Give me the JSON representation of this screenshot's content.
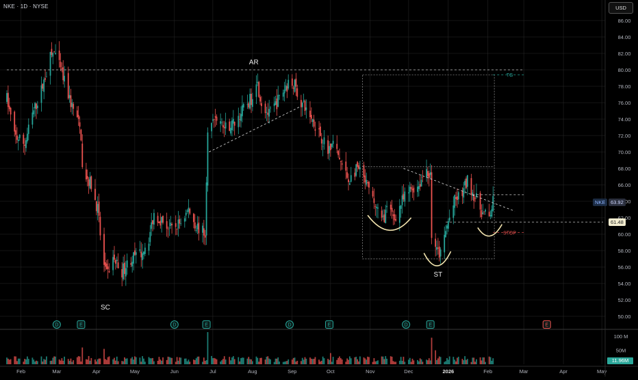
{
  "header": {
    "ticker_line": "NKE · 1D · NYSE",
    "currency": "USD"
  },
  "price_badges": {
    "symbol": "NKE",
    "last": "63.92",
    "level": "61.48"
  },
  "volume_last": "11.96M",
  "colors": {
    "up": "#26a69a",
    "down": "#ef5350",
    "annotation": "#f5e6b0",
    "target": "#26a69a",
    "stop": "#ef5350",
    "grid": "#2a2a2a"
  },
  "annotations": {
    "sc": "SC",
    "ar": "AR",
    "st": "ST",
    "tg": "TG",
    "stop": "STOP"
  },
  "event_markers": [
    {
      "label": "D",
      "kind": "dividend",
      "date": "2025-03-01"
    },
    {
      "label": "E",
      "kind": "earnings",
      "date": "2025-03-20"
    },
    {
      "label": "D",
      "kind": "dividend",
      "date": "2025-06-01"
    },
    {
      "label": "E",
      "kind": "earnings",
      "date": "2025-06-26"
    },
    {
      "label": "D",
      "kind": "dividend",
      "date": "2025-08-30"
    },
    {
      "label": "E",
      "kind": "earnings",
      "date": "2025-09-30"
    },
    {
      "label": "D",
      "kind": "dividend",
      "date": "2025-11-29"
    },
    {
      "label": "E",
      "kind": "earnings",
      "date": "2025-12-18"
    },
    {
      "label": "E",
      "kind": "earnings-upcoming",
      "date": "2026-03-19"
    }
  ],
  "chart_data": {
    "type": "candlestick",
    "title": "NKE · 1D · NYSE",
    "y_axis": {
      "side": "right",
      "unit": "USD",
      "min": 49,
      "max": 87,
      "ticks": [
        50,
        52,
        54,
        56,
        58,
        60,
        62,
        64,
        66,
        68,
        70,
        72,
        74,
        76,
        78,
        80,
        82,
        84,
        86
      ],
      "tick_labels": [
        "50.00",
        "52.00",
        "54.00",
        "56.00",
        "58.00",
        "60.00",
        "62.00",
        "64.00",
        "66.00",
        "68.00",
        "70.00",
        "72.00",
        "74.00",
        "76.00",
        "78.00",
        "80.00",
        "82.00",
        "84.00",
        "86.00"
      ]
    },
    "x_axis": {
      "ticks": [
        "2025-02-01",
        "2025-03-01",
        "2025-04-01",
        "2025-05-01",
        "2025-06-01",
        "2025-07-01",
        "2025-08-01",
        "2025-09-01",
        "2025-10-01",
        "2025-11-01",
        "2025-12-01",
        "2026-01-01",
        "2026-02-01",
        "2026-03-01",
        "2026-04-01",
        "2026-05-01"
      ],
      "tick_labels": [
        "Feb",
        "Mar",
        "Apr",
        "May",
        "Jun",
        "Jul",
        "Aug",
        "Sep",
        "Oct",
        "Nov",
        "Dec",
        "2026",
        "Feb",
        "Mar",
        "Apr",
        "May"
      ],
      "range": [
        "2025-01-21",
        "2026-05-02"
      ]
    },
    "volume_axis": {
      "tick_labels": [
        "100 M",
        "50M"
      ],
      "ticks": [
        100,
        50
      ],
      "max": 120,
      "unit": "M"
    },
    "price_path": [
      [
        "2025-01-21",
        76.5
      ],
      [
        "2025-01-27",
        72.0
      ],
      [
        "2025-02-04",
        71.0
      ],
      [
        "2025-02-10",
        74.5
      ],
      [
        "2025-02-17",
        77.5
      ],
      [
        "2025-02-24",
        81.5
      ],
      [
        "2025-02-27",
        82.2
      ],
      [
        "2025-03-05",
        79.5
      ],
      [
        "2025-03-12",
        76.0
      ],
      [
        "2025-03-17",
        74.0
      ],
      [
        "2025-03-20",
        72.0
      ],
      [
        "2025-03-21",
        68.0
      ],
      [
        "2025-03-28",
        66.0
      ],
      [
        "2025-04-02",
        63.0
      ],
      [
        "2025-04-04",
        60.0
      ],
      [
        "2025-04-07",
        56.0
      ],
      [
        "2025-04-09",
        55.0
      ],
      [
        "2025-04-14",
        57.0
      ],
      [
        "2025-04-21",
        55.5
      ],
      [
        "2025-04-28",
        57.0
      ],
      [
        "2025-05-05",
        57.5
      ],
      [
        "2025-05-12",
        59.5
      ],
      [
        "2025-05-16",
        62.5
      ],
      [
        "2025-05-23",
        61.5
      ],
      [
        "2025-05-30",
        60.5
      ],
      [
        "2025-06-06",
        61.5
      ],
      [
        "2025-06-12",
        63.0
      ],
      [
        "2025-06-18",
        61.0
      ],
      [
        "2025-06-25",
        60.0
      ],
      [
        "2025-06-27",
        72.0
      ],
      [
        "2025-07-03",
        74.5
      ],
      [
        "2025-07-10",
        73.0
      ],
      [
        "2025-07-17",
        73.5
      ],
      [
        "2025-07-24",
        75.0
      ],
      [
        "2025-07-31",
        76.5
      ],
      [
        "2025-08-04",
        79.0
      ],
      [
        "2025-08-08",
        76.0
      ],
      [
        "2025-08-14",
        74.5
      ],
      [
        "2025-08-20",
        76.0
      ],
      [
        "2025-08-27",
        78.0
      ],
      [
        "2025-09-02",
        78.5
      ],
      [
        "2025-09-08",
        76.0
      ],
      [
        "2025-09-15",
        74.5
      ],
      [
        "2025-09-22",
        72.5
      ],
      [
        "2025-09-29",
        70.0
      ],
      [
        "2025-10-02",
        71.5
      ],
      [
        "2025-10-08",
        69.0
      ],
      [
        "2025-10-15",
        66.5
      ],
      [
        "2025-10-22",
        68.0
      ],
      [
        "2025-10-29",
        66.0
      ],
      [
        "2025-11-05",
        63.5
      ],
      [
        "2025-11-10",
        61.5
      ],
      [
        "2025-11-14",
        63.0
      ],
      [
        "2025-11-20",
        62.0
      ],
      [
        "2025-11-26",
        64.0
      ],
      [
        "2025-12-03",
        65.5
      ],
      [
        "2025-12-09",
        66.0
      ],
      [
        "2025-12-15",
        68.0
      ],
      [
        "2025-12-18",
        67.0
      ],
      [
        "2025-12-19",
        60.0
      ],
      [
        "2025-12-22",
        58.0
      ],
      [
        "2025-12-26",
        57.5
      ],
      [
        "2025-12-31",
        61.0
      ],
      [
        "2026-01-06",
        64.0
      ],
      [
        "2026-01-12",
        65.0
      ],
      [
        "2026-01-16",
        66.5
      ],
      [
        "2026-01-22",
        64.5
      ],
      [
        "2026-01-28",
        62.5
      ],
      [
        "2026-02-02",
        62.0
      ],
      [
        "2026-02-05",
        63.9
      ]
    ],
    "levels": [
      {
        "label": "AR",
        "value": 80.0,
        "style": "dashed",
        "from": "2025-01-21",
        "to": "2026-03-01"
      },
      {
        "label": "TG",
        "value": 79.4,
        "style": "dashed",
        "from": "2026-02-05",
        "to": "2026-03-01"
      },
      {
        "label": "",
        "value": 64.8,
        "style": "dashed",
        "from": "2026-01-20",
        "to": "2026-03-01"
      },
      {
        "label": "",
        "value": 61.48,
        "style": "dashed",
        "from": "2025-12-30",
        "to": "2026-05-02"
      },
      {
        "label": "STOP",
        "value": 60.2,
        "style": "dashed",
        "from": "2026-02-05",
        "to": "2026-03-01"
      }
    ],
    "trendlines": [
      {
        "from": [
          "2025-06-28",
          70.0
        ],
        "to": [
          "2025-09-07",
          75.5
        ]
      },
      {
        "from": [
          "2025-11-27",
          68.0
        ],
        "to": [
          "2026-02-22",
          62.8
        ]
      }
    ],
    "range_box": {
      "from": "2025-10-26",
      "to": "2026-02-06",
      "top": 79.4,
      "bottom": 57.0,
      "mid": 68.2
    },
    "labels": [
      {
        "text": "SC",
        "date": "2025-04-08",
        "value": 51.1
      },
      {
        "text": "AR",
        "date": "2025-08-02",
        "value": 80.9
      },
      {
        "text": "ST",
        "date": "2025-12-24",
        "value": 55.1
      },
      {
        "text": "TG",
        "date": "2026-02-18",
        "value": 79.4
      },
      {
        "text": "STOP",
        "date": "2026-02-18",
        "value": 60.2
      }
    ],
    "arcs": [
      {
        "from": [
          "2025-10-30",
          62.3
        ],
        "to": [
          "2025-12-03",
          62.0
        ],
        "depth": 2.0
      },
      {
        "from": [
          "2025-12-13",
          57.7
        ],
        "to": [
          "2026-01-03",
          57.9
        ],
        "depth": 2.0
      },
      {
        "from": [
          "2026-01-24",
          60.8
        ],
        "to": [
          "2026-02-12",
          61.2
        ],
        "depth": 1.4
      }
    ]
  }
}
